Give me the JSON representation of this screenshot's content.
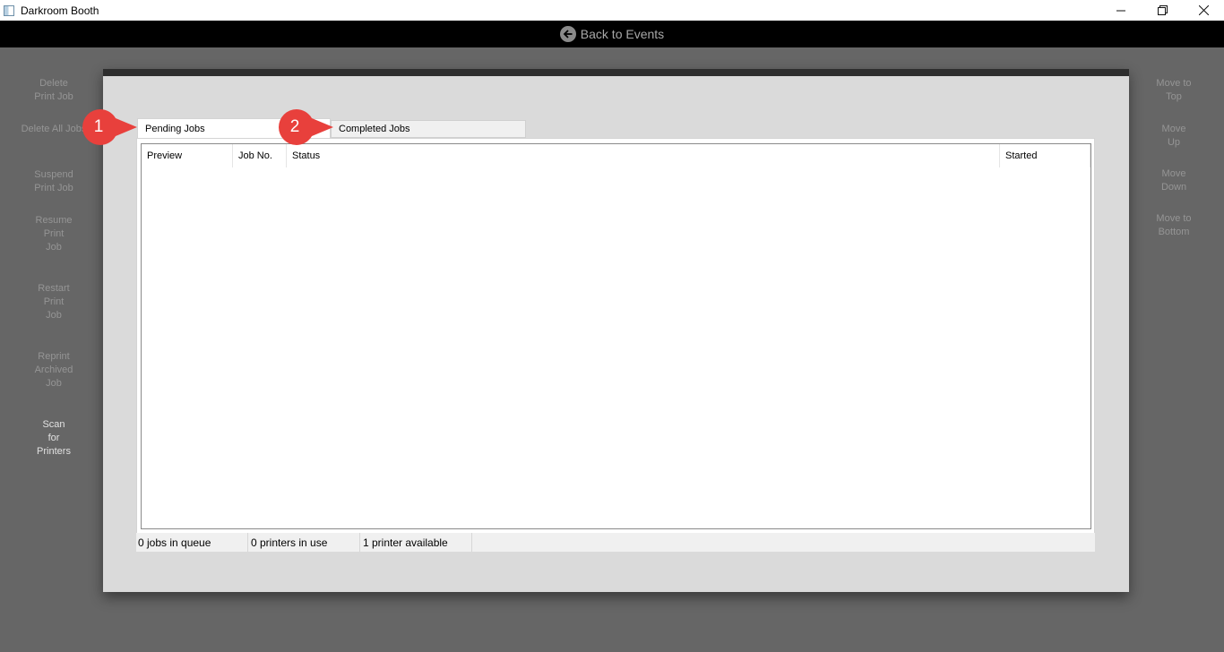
{
  "window": {
    "title": "Darkroom Booth",
    "controls": [
      "minimize-icon",
      "restore-icon",
      "close-icon"
    ]
  },
  "navbar": {
    "back_label": "Back to Events",
    "back_icon": "arrow-left-circle-icon"
  },
  "left_panel": {
    "items": [
      {
        "label": "Delete\nPrint Job",
        "enabled": false
      },
      {
        "label": "Delete All Jobs",
        "enabled": false
      },
      {
        "label": "Suspend\nPrint Job",
        "enabled": false
      },
      {
        "label": "Resume\nPrint\nJob",
        "enabled": false
      },
      {
        "label": "Restart\nPrint\nJob",
        "enabled": false
      },
      {
        "label": "Reprint\nArchived\nJob",
        "enabled": false
      },
      {
        "label": "Scan\nfor\nPrinters",
        "enabled": true
      }
    ]
  },
  "right_panel": {
    "items": [
      {
        "label": "Move to\nTop",
        "enabled": false
      },
      {
        "label": "Move\nUp",
        "enabled": false
      },
      {
        "label": "Move\nDown",
        "enabled": false
      },
      {
        "label": "Move to\nBottom",
        "enabled": false
      }
    ]
  },
  "tabs": [
    {
      "label": "Pending Jobs",
      "active": true
    },
    {
      "label": "Completed Jobs",
      "active": false
    }
  ],
  "table": {
    "columns": [
      "Preview",
      "Job No.",
      "Status",
      "Started"
    ],
    "rows": []
  },
  "status": {
    "jobs_in_queue": "0 jobs in queue",
    "printers_in_use": "0 printers in use",
    "printers_available": "1 printer available"
  },
  "callouts": [
    "1",
    "2"
  ],
  "colors": {
    "callout": "#e8403c",
    "background": "#666666",
    "navbar": "#000000"
  }
}
